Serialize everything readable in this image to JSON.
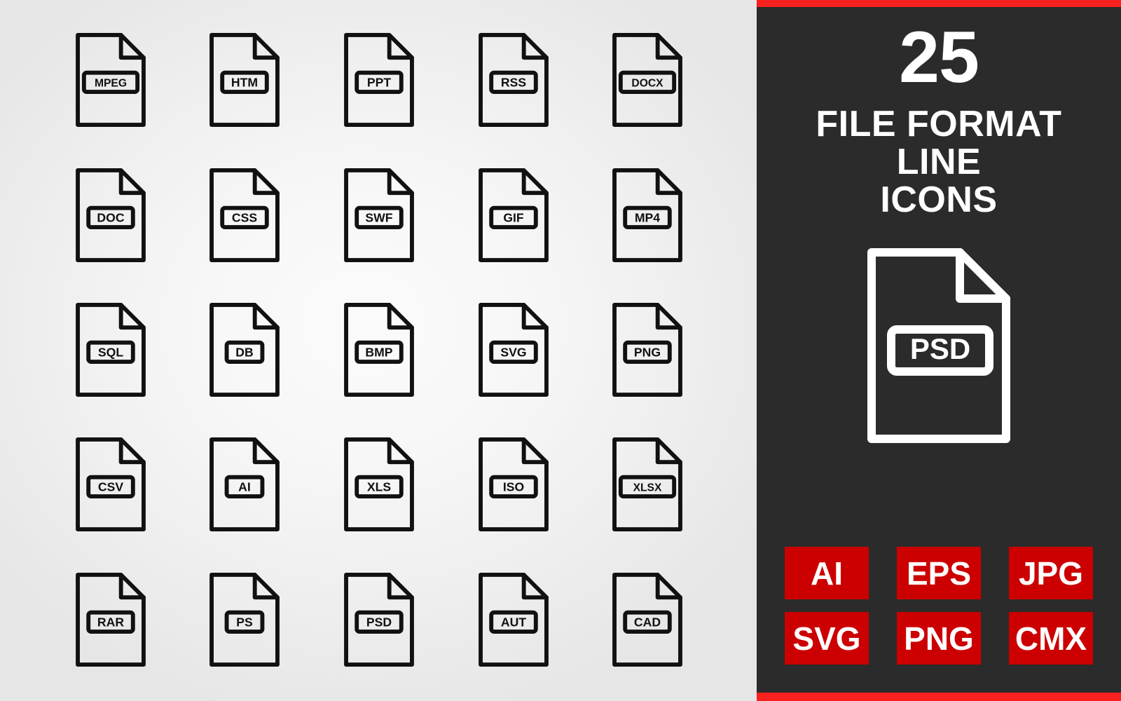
{
  "theme": {
    "accent_red": "#f92020",
    "badge_red": "#cc0000",
    "panel_dark": "#2b2b2b",
    "icon_stroke": "#111111",
    "canvas_light": "#f2f2f2"
  },
  "cover": {
    "count": "25",
    "title_lines": [
      "FILE FORMAT",
      "LINE",
      "ICONS"
    ],
    "hero_icon_label": "PSD",
    "badges": [
      "AI",
      "EPS",
      "JPG",
      "SVG",
      "PNG",
      "CMX"
    ]
  },
  "grid": {
    "columns": 5,
    "rows": 5,
    "icons": [
      {
        "label": "MPEG"
      },
      {
        "label": "HTM"
      },
      {
        "label": "PPT"
      },
      {
        "label": "RSS"
      },
      {
        "label": "DOCX"
      },
      {
        "label": "DOC"
      },
      {
        "label": "CSS"
      },
      {
        "label": "SWF"
      },
      {
        "label": "GIF"
      },
      {
        "label": "MP4"
      },
      {
        "label": "SQL"
      },
      {
        "label": "DB"
      },
      {
        "label": "BMP"
      },
      {
        "label": "SVG"
      },
      {
        "label": "PNG"
      },
      {
        "label": "CSV"
      },
      {
        "label": "AI"
      },
      {
        "label": "XLS"
      },
      {
        "label": "ISO"
      },
      {
        "label": "XLSX"
      },
      {
        "label": "RAR"
      },
      {
        "label": "PS"
      },
      {
        "label": "PSD"
      },
      {
        "label": "AUT"
      },
      {
        "label": "CAD"
      }
    ]
  }
}
